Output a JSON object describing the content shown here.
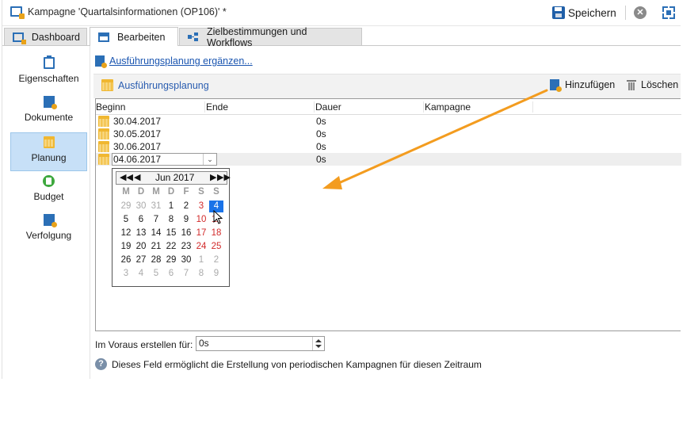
{
  "window": {
    "title": "Kampagne 'Quartalsinformationen (OP106)' *",
    "save_label": "Speichern",
    "close_symbol": "✕"
  },
  "tabs": [
    {
      "label": "Dashboard",
      "icon": "dashboard-icon",
      "active": false
    },
    {
      "label": "Bearbeiten",
      "icon": "edit-icon",
      "active": true
    },
    {
      "label": "Zielbestimmungen und Workflows",
      "icon": "workflow-icon",
      "active": false
    }
  ],
  "sidebar": {
    "items": [
      {
        "label": "Eigenschaften",
        "icon": "clipboard-icon",
        "active": false
      },
      {
        "label": "Dokumente",
        "icon": "document-icon",
        "active": false
      },
      {
        "label": "Planung",
        "icon": "calendar-icon",
        "active": true
      },
      {
        "label": "Budget",
        "icon": "budget-icon",
        "active": false
      },
      {
        "label": "Verfolgung",
        "icon": "tracking-icon",
        "active": false
      }
    ]
  },
  "main": {
    "add_link": "Ausführungsplanung ergänzen...",
    "toolbar": {
      "title": "Ausführungsplanung",
      "add_label": "Hinzufügen",
      "delete_label": "Löschen"
    },
    "table": {
      "columns": [
        "Beginn",
        "Ende",
        "Dauer",
        "Kampagne"
      ],
      "rows": [
        {
          "begin": "30.04.2017",
          "end": "",
          "duration": "0s",
          "campaign": ""
        },
        {
          "begin": "30.05.2017",
          "end": "",
          "duration": "0s",
          "campaign": ""
        },
        {
          "begin": "30.06.2017",
          "end": "",
          "duration": "0s",
          "campaign": ""
        },
        {
          "begin": "04.06.2017",
          "end": "",
          "duration": "0s",
          "campaign": "",
          "editing": true
        }
      ]
    },
    "datepicker": {
      "month_label": "Jun 2017",
      "prev_year": "◀◀",
      "prev_month": "◀",
      "next_month": "▶",
      "next_year": "▶▶",
      "weekdays": [
        "M",
        "D",
        "M",
        "D",
        "F",
        "S",
        "S"
      ],
      "weeks": [
        [
          "29",
          "30",
          "31",
          "1",
          "2",
          "3",
          "4"
        ],
        [
          "5",
          "6",
          "7",
          "8",
          "9",
          "10",
          "11"
        ],
        [
          "12",
          "13",
          "14",
          "15",
          "16",
          "17",
          "18"
        ],
        [
          "19",
          "20",
          "21",
          "22",
          "23",
          "24",
          "25"
        ],
        [
          "26",
          "27",
          "28",
          "29",
          "30",
          "1",
          "2"
        ],
        [
          "3",
          "4",
          "5",
          "6",
          "7",
          "8",
          "9"
        ]
      ],
      "selected_day": "4"
    },
    "advance": {
      "label": "Im Voraus erstellen für:",
      "value": "0s"
    },
    "info_text": "Dieses Feld ermöglicht die Erstellung von periodischen Kampagnen für diesen Zeitraum"
  },
  "colors": {
    "accent_blue": "#2b6fb6",
    "sidebar_active": "#c7e0f7",
    "weekend_red": "#d22a2a",
    "selected_day": "#1a73e8",
    "annotation_arrow": "#f39c1f"
  }
}
